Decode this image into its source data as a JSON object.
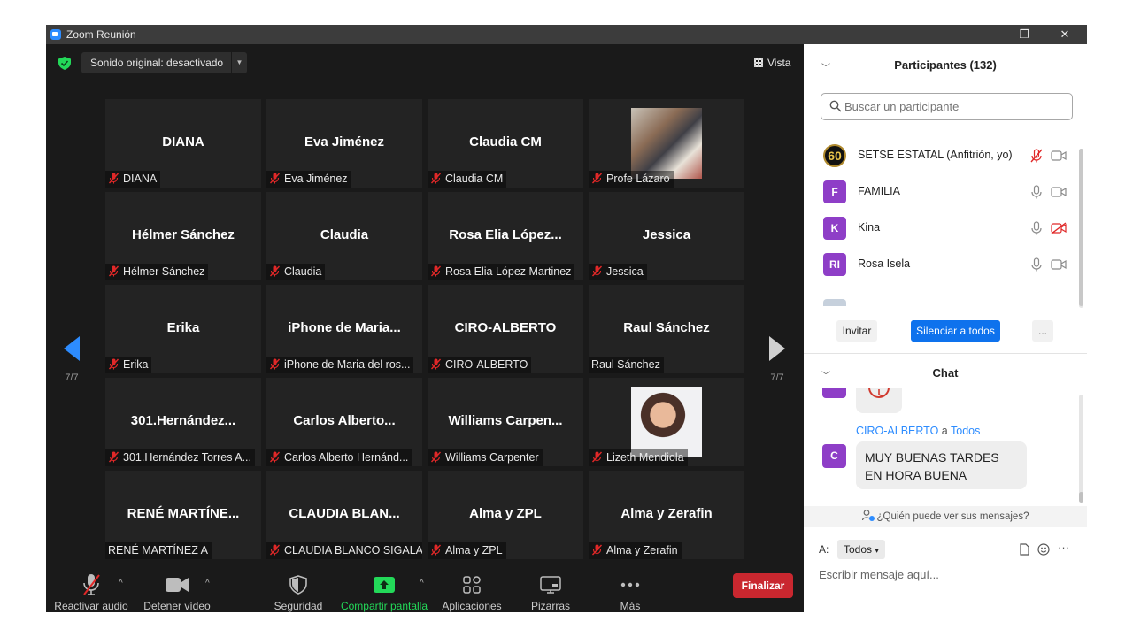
{
  "window": {
    "title": "Zoom Reunión",
    "minimize": "—",
    "restore": "❐",
    "close": "✕"
  },
  "top_bar": {
    "original_sound": "Sonido original: desactivado",
    "view_label": "Vista"
  },
  "gallery": {
    "page_left": "7/7",
    "page_right": "7/7",
    "tiles": [
      {
        "name": "DIANA",
        "label": "DIANA",
        "muted": true
      },
      {
        "name": "Eva Jiménez",
        "label": "Eva Jiménez",
        "muted": true
      },
      {
        "name": "Claudia CM",
        "label": "Claudia CM",
        "muted": true
      },
      {
        "name": "",
        "label": "Profe Lázaro",
        "muted": true,
        "photo": true
      },
      {
        "name": "Hélmer Sánchez",
        "label": "Hélmer Sánchez",
        "muted": true
      },
      {
        "name": "Claudia",
        "label": "Claudia",
        "muted": true
      },
      {
        "name": "Rosa Elia López...",
        "label": "Rosa Elia López Martinez",
        "muted": true
      },
      {
        "name": "Jessica",
        "label": "Jessica",
        "muted": true
      },
      {
        "name": "Erika",
        "label": "Erika",
        "muted": true
      },
      {
        "name": "iPhone de Maria...",
        "label": "iPhone de Maria del ros...",
        "muted": true
      },
      {
        "name": "CIRO-ALBERTO",
        "label": "CIRO-ALBERTO",
        "muted": true
      },
      {
        "name": "Raul Sánchez",
        "label": "Raul Sánchez",
        "muted": false
      },
      {
        "name": "301.Hernández...",
        "label": "301.Hernández Torres A...",
        "muted": true
      },
      {
        "name": "Carlos Alberto...",
        "label": "Carlos Alberto Hernánd...",
        "muted": true
      },
      {
        "name": "Williams Carpen...",
        "label": "Williams Carpenter",
        "muted": true
      },
      {
        "name": "",
        "label": "Lizeth Mendiola",
        "muted": true,
        "photo": true
      },
      {
        "name": "RENÉ MARTÍNE...",
        "label": "RENÉ MARTÍNEZ A",
        "muted": false
      },
      {
        "name": "CLAUDIA BLAN...",
        "label": "CLAUDIA BLANCO SIGALA",
        "muted": true
      },
      {
        "name": "Alma y ZPL",
        "label": "Alma y ZPL",
        "muted": true
      },
      {
        "name": "Alma y Zerafin",
        "label": "Alma y Zerafin",
        "muted": true
      }
    ]
  },
  "toolbar": {
    "unmute": "Reactivar audio",
    "stop_video": "Detener vídeo",
    "security": "Seguridad",
    "share": "Compartir pantalla",
    "apps": "Aplicaciones",
    "whiteboards": "Pizarras",
    "more": "Más",
    "end": "Finalizar"
  },
  "participants": {
    "header": "Participantes (132)",
    "search_placeholder": "Buscar un participante",
    "list": [
      {
        "initials": "60",
        "name": "SETSE ESTATAL (Anfitrión, yo)"
      },
      {
        "initials": "F",
        "name": "FAMILIA"
      },
      {
        "initials": "K",
        "name": "Kina"
      },
      {
        "initials": "RI",
        "name": "Rosa Isela"
      }
    ],
    "invite": "Invitar",
    "mute_all": "Silenciar a todos",
    "more": "..."
  },
  "chat": {
    "header": "Chat",
    "sender_initial": "C",
    "sender": "CIRO-ALBERTO",
    "to_word": "a",
    "to": "Todos",
    "message": "MUY BUENAS TARDES EN HORA BUENA",
    "who_can_see": "¿Quién puede ver sus mensajes?",
    "to_label": "A:",
    "recipient": "Todos",
    "input_placeholder": "Escribir mensaje aquí...",
    "more": "···"
  },
  "colors": {
    "accent": "#2d8cff",
    "share": "#23d959",
    "end": "#c9272f",
    "avatar": "#8e3ec7",
    "mute_red": "#e02828"
  }
}
